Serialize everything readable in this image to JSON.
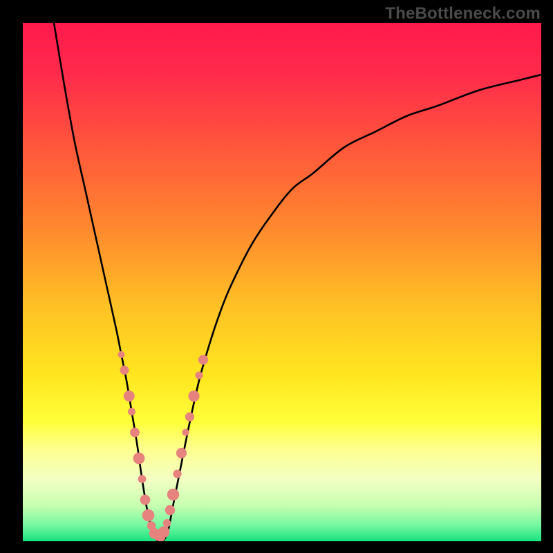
{
  "watermark": "TheBottleneck.com",
  "chart_data": {
    "type": "line",
    "title": "",
    "xlabel": "",
    "ylabel": "",
    "xlim": [
      0,
      100
    ],
    "ylim": [
      0,
      100
    ],
    "gradient_stops": [
      {
        "offset": 0.0,
        "color": "#ff1a4d"
      },
      {
        "offset": 0.1,
        "color": "#ff2b4b"
      },
      {
        "offset": 0.25,
        "color": "#ff5a3a"
      },
      {
        "offset": 0.4,
        "color": "#ff8a2e"
      },
      {
        "offset": 0.55,
        "color": "#ffc224"
      },
      {
        "offset": 0.68,
        "color": "#ffe61f"
      },
      {
        "offset": 0.77,
        "color": "#ffff3a"
      },
      {
        "offset": 0.82,
        "color": "#feff8c"
      },
      {
        "offset": 0.88,
        "color": "#f3ffc3"
      },
      {
        "offset": 0.93,
        "color": "#c8ffb0"
      },
      {
        "offset": 0.97,
        "color": "#73f7a0"
      },
      {
        "offset": 1.0,
        "color": "#16e27e"
      }
    ],
    "series": [
      {
        "name": "bottleneck-curve",
        "color": "#000000",
        "x": [
          6,
          8,
          10,
          12,
          14,
          16,
          18,
          19,
          20,
          21,
          22,
          23,
          24,
          25,
          26,
          27,
          28,
          29,
          30,
          32,
          34,
          36,
          38,
          40,
          44,
          48,
          52,
          56,
          62,
          68,
          74,
          80,
          88,
          96,
          100
        ],
        "y": [
          100,
          88,
          77,
          68,
          59,
          50,
          41,
          36,
          31,
          25,
          19,
          12,
          6,
          2,
          0,
          0,
          2,
          7,
          12,
          22,
          31,
          38,
          44,
          49,
          57,
          63,
          68,
          71,
          76,
          79,
          82,
          84,
          87,
          89,
          90
        ]
      }
    ],
    "markers": {
      "name": "highlight-dots",
      "color": "#e6837e",
      "radius_range": [
        5,
        9
      ],
      "points": [
        {
          "x": 19.0,
          "y": 36
        },
        {
          "x": 19.6,
          "y": 33
        },
        {
          "x": 20.5,
          "y": 28
        },
        {
          "x": 21.0,
          "y": 25
        },
        {
          "x": 21.6,
          "y": 21
        },
        {
          "x": 22.4,
          "y": 16
        },
        {
          "x": 23.0,
          "y": 12
        },
        {
          "x": 23.6,
          "y": 8
        },
        {
          "x": 24.2,
          "y": 5
        },
        {
          "x": 24.8,
          "y": 3
        },
        {
          "x": 25.4,
          "y": 1.5
        },
        {
          "x": 26.0,
          "y": 0.8
        },
        {
          "x": 26.6,
          "y": 0.8
        },
        {
          "x": 27.2,
          "y": 1.8
        },
        {
          "x": 27.8,
          "y": 3.5
        },
        {
          "x": 28.4,
          "y": 6
        },
        {
          "x": 29.0,
          "y": 9
        },
        {
          "x": 29.8,
          "y": 13
        },
        {
          "x": 30.6,
          "y": 17
        },
        {
          "x": 31.4,
          "y": 21
        },
        {
          "x": 32.2,
          "y": 24
        },
        {
          "x": 33.0,
          "y": 28
        },
        {
          "x": 34.0,
          "y": 32
        },
        {
          "x": 34.8,
          "y": 35
        }
      ]
    }
  }
}
